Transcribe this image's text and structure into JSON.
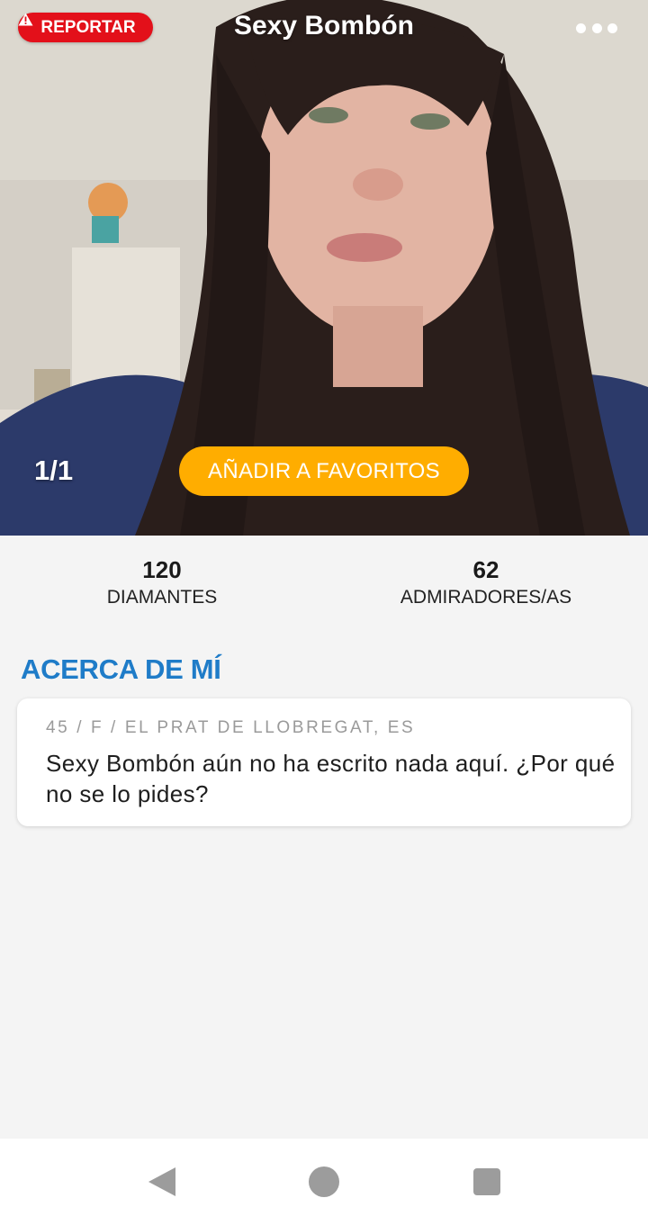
{
  "header": {
    "report_label": "REPORTAR",
    "title": "Sexy Bombón",
    "photo_counter": "1/1",
    "favorite_label": "AÑADIR A FAVORITOS"
  },
  "stats": [
    {
      "value": "120",
      "label": "DIAMANTES"
    },
    {
      "value": "62",
      "label": "ADMIRADORES/AS"
    }
  ],
  "about": {
    "heading": "ACERCA DE MÍ",
    "meta": "45 / F / EL PRAT DE LLOBREGAT, ES",
    "text": "Sexy Bombón aún no ha escrito nada aquí. ¿Por qué no se lo pides?"
  },
  "icons": {
    "report": "warning-triangle-icon",
    "more": "more-dots-icon",
    "back": "nav-back-icon",
    "home": "nav-home-icon",
    "recent": "nav-recent-icon"
  },
  "colors": {
    "report_red": "#e3101a",
    "favorite_yellow": "#ffad00",
    "heading_blue": "#1f7cc8",
    "page_bg": "#f4f4f4"
  }
}
